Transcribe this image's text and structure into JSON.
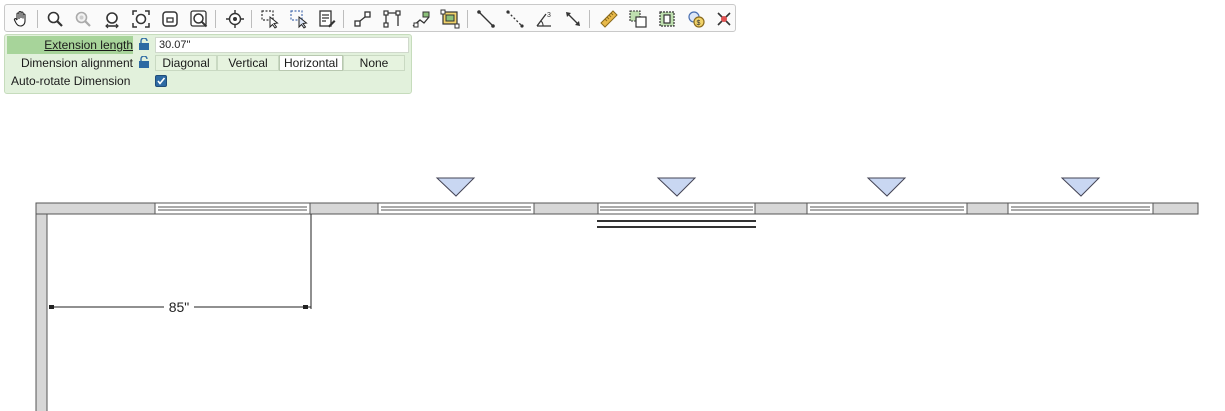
{
  "toolbar": {
    "tools": [
      {
        "icon": "pan-hand-icon"
      },
      {
        "icon": "zoom-icon"
      },
      {
        "icon": "zoom-out-icon"
      },
      {
        "icon": "zoom-extents-icon"
      },
      {
        "icon": "zoom-fit-icon"
      },
      {
        "icon": "zoom-window-icon"
      },
      {
        "icon": "zoom-previous-icon"
      },
      {
        "icon": "center-view-icon"
      },
      {
        "icon": "select-objects-icon"
      },
      {
        "icon": "select-similar-icon"
      },
      {
        "icon": "edit-properties-icon"
      },
      {
        "icon": "wall-point-icon"
      },
      {
        "icon": "wall-corner-icon"
      },
      {
        "icon": "room-edit-icon"
      },
      {
        "icon": "room-fill-icon"
      },
      {
        "icon": "dimension-line-icon"
      },
      {
        "icon": "dimension-dashed-icon"
      },
      {
        "icon": "angle-dimension-icon"
      },
      {
        "icon": "arrow-dimension-icon"
      },
      {
        "icon": "ruler-icon"
      },
      {
        "icon": "copy-area-icon"
      },
      {
        "icon": "frame-select-icon"
      },
      {
        "icon": "cost-estimate-icon"
      },
      {
        "icon": "delete-icon"
      }
    ]
  },
  "properties": {
    "extension_length_label": "Extension length",
    "extension_length_value": "30.07\"",
    "dimension_alignment_label": "Dimension alignment",
    "alignment_options": [
      "Diagonal",
      "Vertical",
      "Horizontal",
      "None"
    ],
    "selected_alignment": "Horizontal",
    "auto_rotate_label": "Auto-rotate Dimension",
    "auto_rotate_checked": true
  },
  "drawing": {
    "dimension_label": "85\""
  },
  "colors": {
    "panel_bg": "#e2f1dc",
    "highlight": "#a7d49a",
    "wall_fill": "#d7d7d7",
    "marker_fill": "#c9d7f2",
    "checkbox": "#2d6aa3"
  }
}
